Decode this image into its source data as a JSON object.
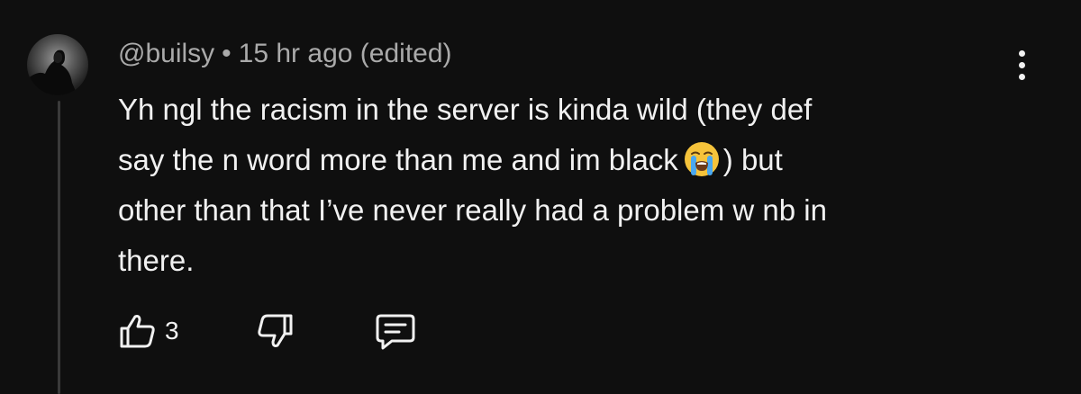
{
  "comment": {
    "author": "@builsy",
    "separator": "•",
    "time_ago": "15 hr ago",
    "edited_label": "(edited)",
    "text_lines": [
      "Yh ngl the racism in the server is kinda wild (they def",
      "say the n word more than me and im black",
      ") but",
      "other than that I’ve never really had a problem w nb in",
      "there."
    ],
    "emoji": "loudly-crying-face-emoji"
  },
  "actions": {
    "like_icon": "thumbs-up-icon",
    "like_count": "3",
    "dislike_icon": "thumbs-down-icon",
    "reply_icon": "comment-icon"
  },
  "menu_icon": "more-vertical-icon"
}
